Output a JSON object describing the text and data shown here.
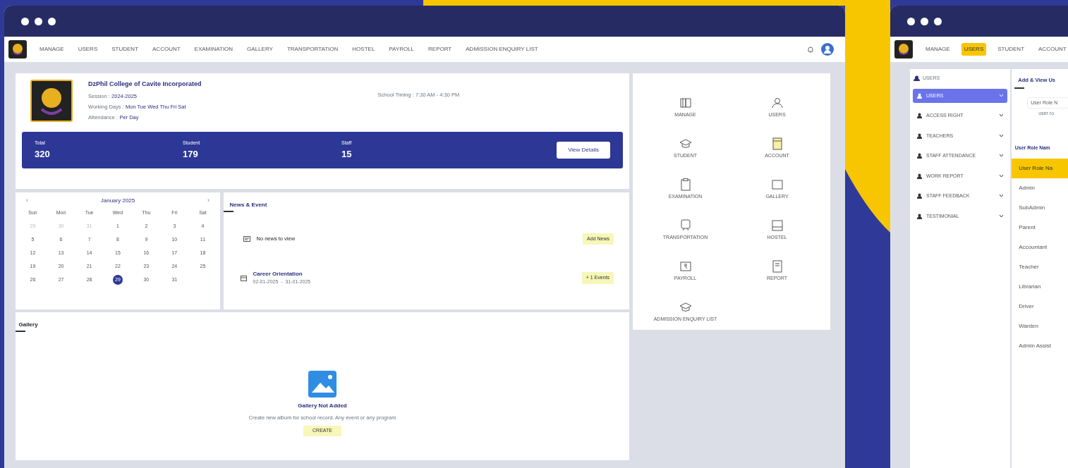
{
  "main_window": {
    "nav": [
      {
        "label": "MANAGE",
        "selected": false
      },
      {
        "label": "USERS",
        "selected": false
      },
      {
        "label": "STUDENT",
        "selected": false
      },
      {
        "label": "ACCOUNT",
        "selected": false
      },
      {
        "label": "EXAMINATION",
        "selected": false
      },
      {
        "label": "GALLERY",
        "selected": false
      },
      {
        "label": "TRANSPORTATION",
        "selected": false
      },
      {
        "label": "HOSTEL",
        "selected": false
      },
      {
        "label": "PAYROLL",
        "selected": false
      },
      {
        "label": "REPORT",
        "selected": false
      },
      {
        "label": "ADMISSION ENQUIRY LIST",
        "selected": false
      }
    ],
    "school": {
      "name": "DzPhil College of Cavite Incorporated",
      "details": [
        {
          "label": "Session :",
          "value": "2024-2025"
        },
        {
          "label": "Working Days :",
          "value": "Mon Tue Wed Thu Fri Sat"
        },
        {
          "label": "Attendance :",
          "value": "Per Day"
        }
      ],
      "timing_label": "School Timing :",
      "timing_value": "7:30 AM - 4:30 PM"
    },
    "stats": [
      {
        "label": "Total",
        "value": "320"
      },
      {
        "label": "Student",
        "value": "179"
      },
      {
        "label": "Staff",
        "value": "15"
      }
    ],
    "view_details": "View Details",
    "calendar": {
      "prev": "‹",
      "title": "January 2025",
      "next": "›",
      "weekdays": [
        "Sun",
        "Mon",
        "Tue",
        "Wed",
        "Thu",
        "Fri",
        "Sat"
      ],
      "days": [
        {
          "day": "29",
          "muted": true,
          "selected": false
        },
        {
          "day": "30",
          "muted": true,
          "selected": false
        },
        {
          "day": "31",
          "muted": true,
          "selected": false
        },
        {
          "day": "1",
          "muted": false,
          "selected": false
        },
        {
          "day": "2",
          "muted": false,
          "selected": false
        },
        {
          "day": "3",
          "muted": false,
          "selected": false
        },
        {
          "day": "4",
          "muted": false,
          "selected": false
        },
        {
          "day": "5",
          "muted": false,
          "selected": false
        },
        {
          "day": "6",
          "muted": false,
          "selected": false
        },
        {
          "day": "7",
          "muted": false,
          "selected": false
        },
        {
          "day": "8",
          "muted": false,
          "selected": false
        },
        {
          "day": "9",
          "muted": false,
          "selected": false
        },
        {
          "day": "10",
          "muted": false,
          "selected": false
        },
        {
          "day": "11",
          "muted": false,
          "selected": false
        },
        {
          "day": "12",
          "muted": false,
          "selected": false
        },
        {
          "day": "13",
          "muted": false,
          "selected": false
        },
        {
          "day": "14",
          "muted": false,
          "selected": false
        },
        {
          "day": "15",
          "muted": false,
          "selected": false
        },
        {
          "day": "16",
          "muted": false,
          "selected": false
        },
        {
          "day": "17",
          "muted": false,
          "selected": false
        },
        {
          "day": "18",
          "muted": false,
          "selected": false
        },
        {
          "day": "19",
          "muted": false,
          "selected": false
        },
        {
          "day": "20",
          "muted": false,
          "selected": false
        },
        {
          "day": "21",
          "muted": false,
          "selected": false
        },
        {
          "day": "22",
          "muted": false,
          "selected": false
        },
        {
          "day": "23",
          "muted": false,
          "selected": false
        },
        {
          "day": "24",
          "muted": false,
          "selected": false
        },
        {
          "day": "25",
          "muted": false,
          "selected": false
        },
        {
          "day": "26",
          "muted": false,
          "selected": false
        },
        {
          "day": "27",
          "muted": false,
          "selected": false
        },
        {
          "day": "28",
          "muted": false,
          "selected": false
        },
        {
          "day": "29",
          "muted": false,
          "selected": true
        },
        {
          "day": "30",
          "muted": false,
          "selected": false
        },
        {
          "day": "31",
          "muted": false,
          "selected": false
        }
      ]
    },
    "news": {
      "title": "News & Event",
      "items": [
        {
          "kind": "news",
          "text": "No news to view",
          "button": "Add News"
        },
        {
          "kind": "event",
          "title": "Career Orientation",
          "dates": "02-01-2025  -  31-01-2025",
          "button": "+ 1 Events"
        }
      ]
    },
    "gallery": {
      "title": "Gallery",
      "empty_title": "Gallery Not Added",
      "empty_text": "Create new album for school record. Any event or any program",
      "button": "CREATE"
    },
    "modules": [
      "MANAGE",
      "USERS",
      "STUDENT",
      "ACCOUNT",
      "EXAMINATION",
      "GALLERY",
      "TRANSPORTATION",
      "HOSTEL",
      "PAYROLL",
      "REPORT",
      "ADMISSION ENQUIRY LIST"
    ]
  },
  "second_window": {
    "nav": [
      {
        "label": "MANAGE",
        "selected": false
      },
      {
        "label": "USERS",
        "selected": true
      },
      {
        "label": "STUDENT",
        "selected": false
      },
      {
        "label": "ACCOUNT",
        "selected": false
      }
    ],
    "sidebar": {
      "title": "USERS",
      "items": [
        {
          "label": "USERS",
          "selected": true
        },
        {
          "label": "ACCESS RIGHT",
          "selected": false
        },
        {
          "label": "TEACHERS",
          "selected": false
        },
        {
          "label": "STAFF ATTENDANCE",
          "selected": false
        },
        {
          "label": "WORK REPORT",
          "selected": false
        },
        {
          "label": "STAFF FEEDBACK",
          "selected": false
        },
        {
          "label": "TESTIMONIAL",
          "selected": false
        }
      ]
    },
    "tab": "Add & View Us",
    "field_placeholder": "User Role N",
    "field_hint": "user ro",
    "table_title": "User Role Nam",
    "table_header": "User Role Na",
    "rows": [
      "Admin",
      "SubAdmin",
      "Parent",
      "Accountant",
      "Teacher",
      "Librarian",
      "Driver",
      "Warden",
      "Admin Assist"
    ]
  }
}
